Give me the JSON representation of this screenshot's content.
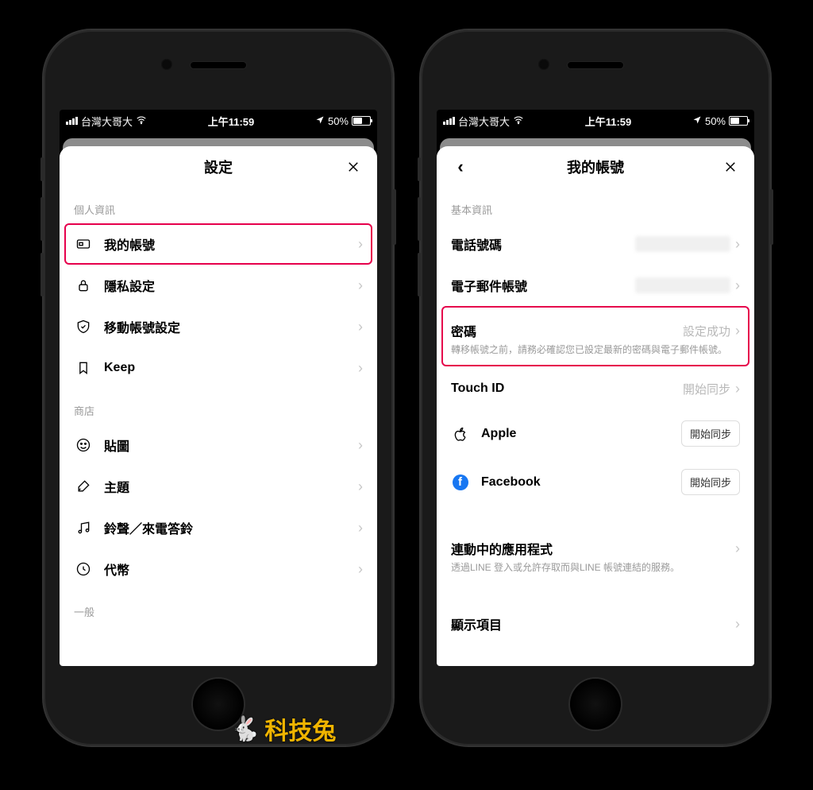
{
  "status": {
    "carrier": "台灣大哥大",
    "time": "上午11:59",
    "battery_pct": "50%"
  },
  "left": {
    "title": "設定",
    "section_personal": "個人資訊",
    "items_personal": [
      {
        "label": "我的帳號"
      },
      {
        "label": "隱私設定"
      },
      {
        "label": "移動帳號設定"
      },
      {
        "label": "Keep"
      }
    ],
    "section_store": "商店",
    "items_store": [
      {
        "label": "貼圖"
      },
      {
        "label": "主題"
      },
      {
        "label": "鈴聲／來電答鈴"
      },
      {
        "label": "代幣"
      }
    ],
    "section_general": "一般"
  },
  "right": {
    "title": "我的帳號",
    "section_basic": "基本資訊",
    "phone_label": "電話號碼",
    "email_label": "電子郵件帳號",
    "password_label": "密碼",
    "password_value": "設定成功",
    "password_desc": "轉移帳號之前，請務必確認您已設定最新的密碼與電子郵件帳號。",
    "touchid_label": "Touch ID",
    "touchid_value": "開始同步",
    "apple_label": "Apple",
    "facebook_label": "Facebook",
    "sync_btn": "開始同步",
    "linked_label": "連動中的應用程式",
    "linked_desc": "透過LINE 登入或允許存取而與LINE 帳號連結的服務。",
    "display_label": "顯示項目"
  },
  "watermark": "科技兔"
}
